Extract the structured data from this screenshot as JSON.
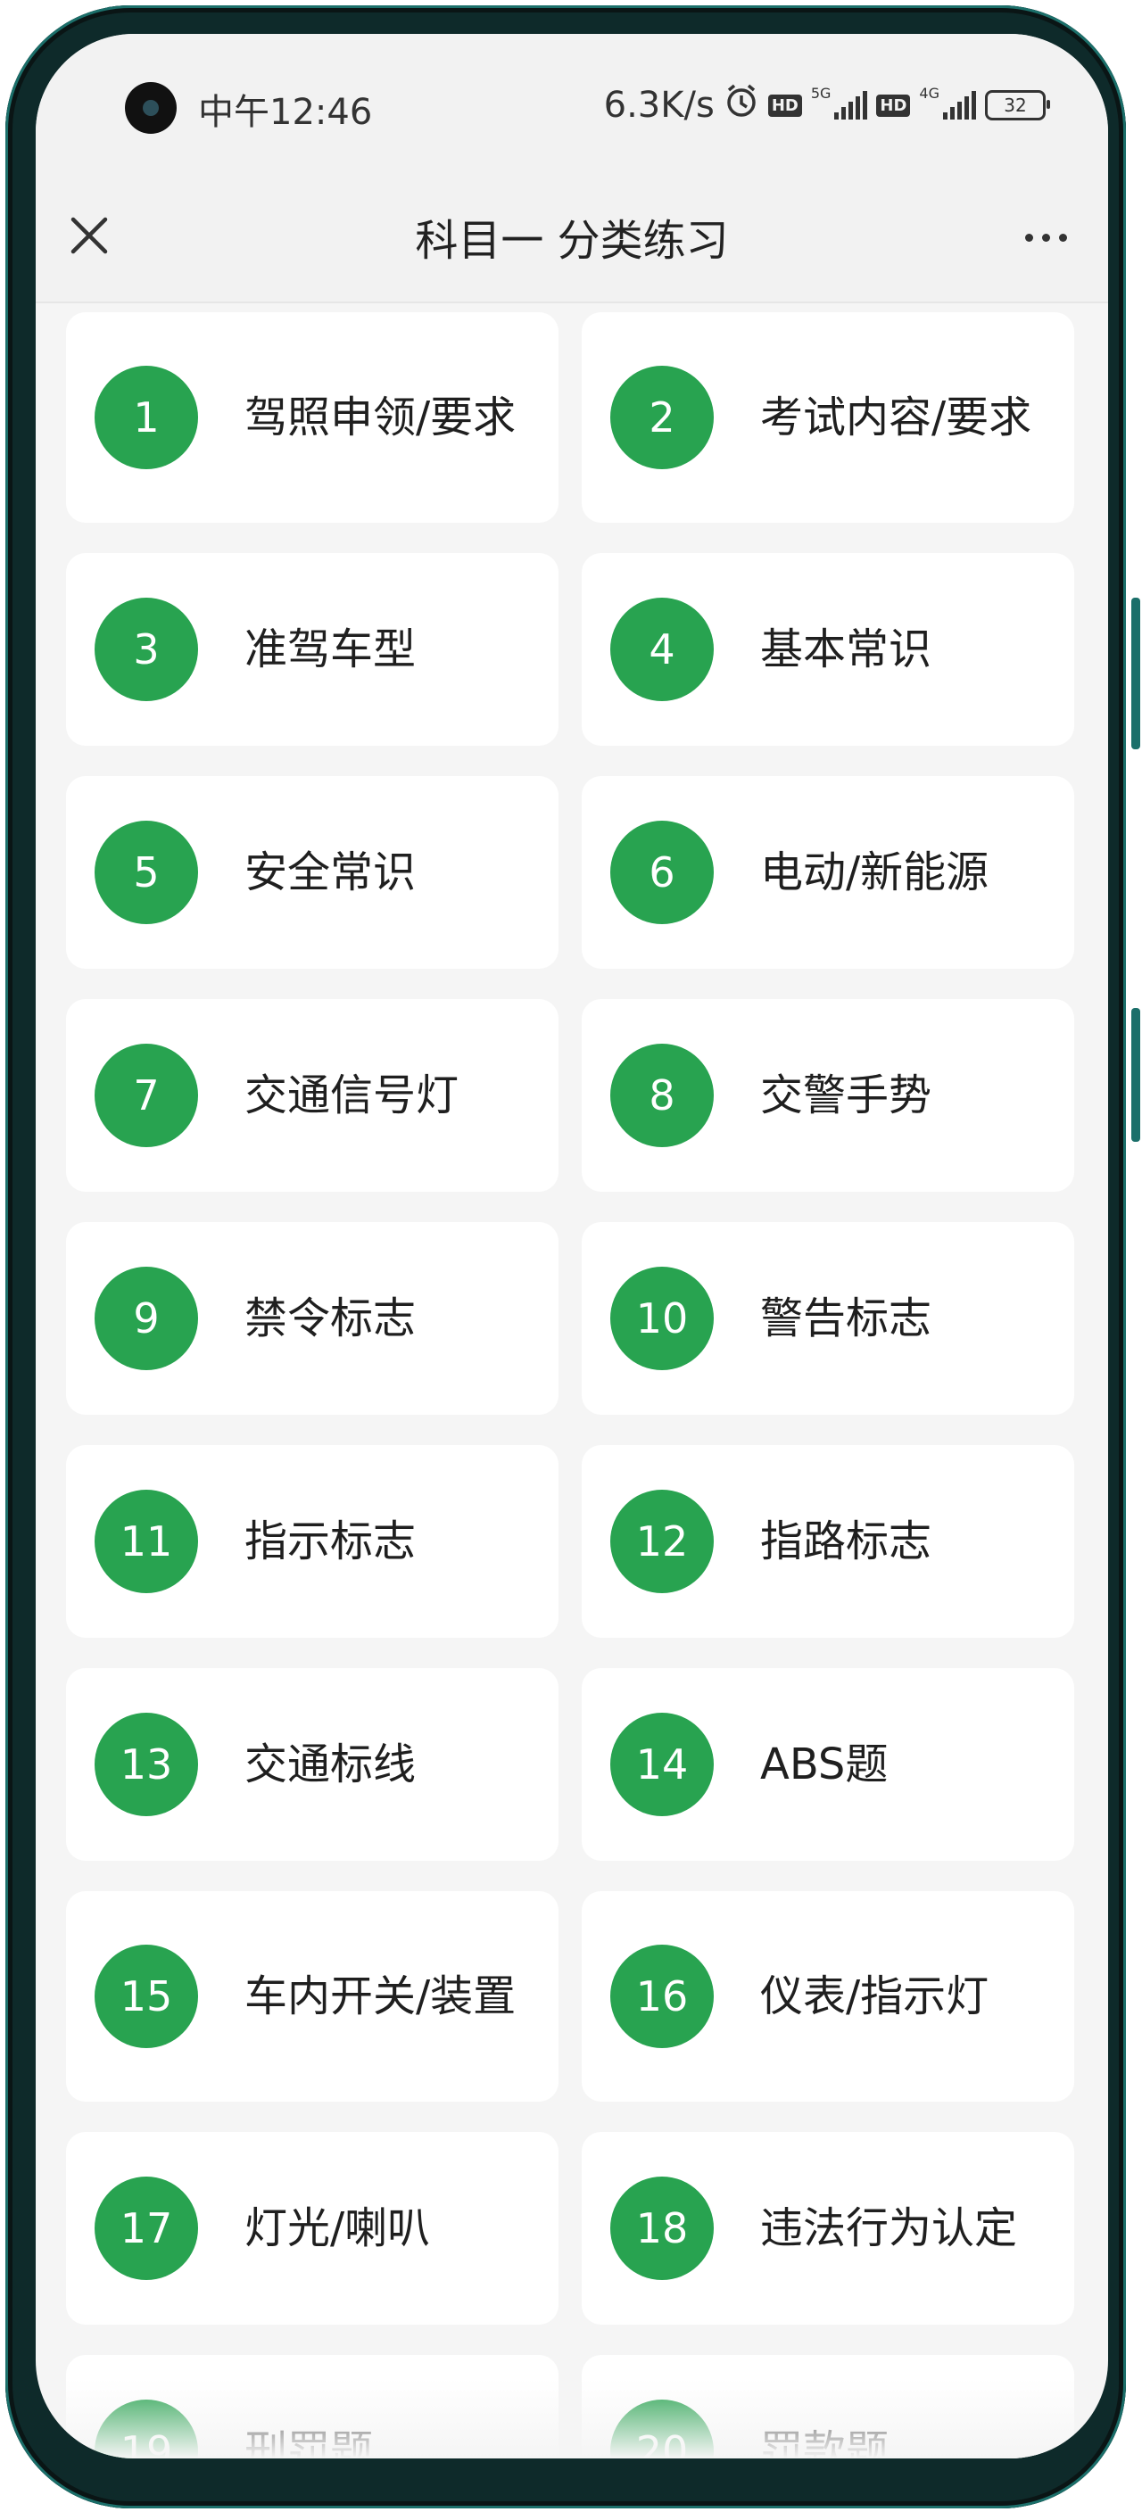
{
  "status_bar": {
    "time": "中午12:46",
    "net_speed": "6.3K/s",
    "hd1": "HD",
    "gen1": "5G",
    "hd2": "HD",
    "gen2": "4G",
    "battery": "32"
  },
  "header": {
    "title": "科目一 分类练习"
  },
  "colors": {
    "accent": "#28a350",
    "background": "#f5f5f5",
    "card": "#ffffff"
  },
  "categories": [
    {
      "num": "1",
      "label": "驾照申领/要求"
    },
    {
      "num": "2",
      "label": "考试内容/要求"
    },
    {
      "num": "3",
      "label": "准驾车型"
    },
    {
      "num": "4",
      "label": "基本常识"
    },
    {
      "num": "5",
      "label": "安全常识"
    },
    {
      "num": "6",
      "label": "电动/新能源"
    },
    {
      "num": "7",
      "label": "交通信号灯"
    },
    {
      "num": "8",
      "label": "交警手势"
    },
    {
      "num": "9",
      "label": "禁令标志"
    },
    {
      "num": "10",
      "label": "警告标志"
    },
    {
      "num": "11",
      "label": "指示标志"
    },
    {
      "num": "12",
      "label": "指路标志"
    },
    {
      "num": "13",
      "label": "交通标线"
    },
    {
      "num": "14",
      "label": "ABS题"
    },
    {
      "num": "15",
      "label": "车内开关/装置"
    },
    {
      "num": "16",
      "label": "仪表/指示灯"
    },
    {
      "num": "17",
      "label": "灯光/喇叭"
    },
    {
      "num": "18",
      "label": "违法行为认定"
    },
    {
      "num": "19",
      "label": "刑罚题"
    },
    {
      "num": "20",
      "label": "罚款题"
    }
  ]
}
